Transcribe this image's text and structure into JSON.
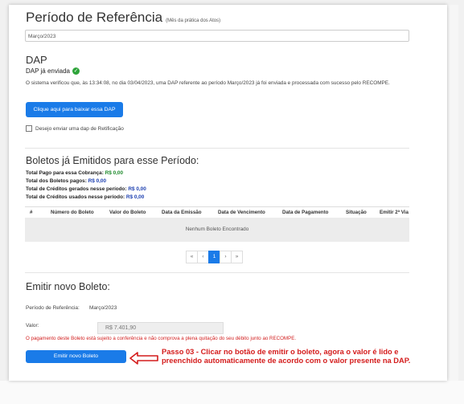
{
  "header": {
    "title": "Período de Referência",
    "subtitle": "(Mês da prática dos Atos)"
  },
  "period_select": {
    "value": "Março/2023"
  },
  "dap": {
    "title": "DAP",
    "status": "DAP já enviada",
    "description": "O sistema verificou que, às 13:34:08, no dia 03/04/2023, uma DAP referente ao período Março/2023 já foi enviada e processada com sucesso pelo RECOMPE.",
    "download_button": "Clique aqui para baixar essa DAP",
    "rectification_label": "Desejo enviar uma dap de Retificação",
    "status_color": "#2ea43a"
  },
  "boletos": {
    "title": "Boletos já Emitidos para esse Período:",
    "summary": [
      {
        "label": "Total Pago para essa Cobrança:",
        "value": "R$ 0,00",
        "color": "#1e8a2c"
      },
      {
        "label": "Total dos Boletos pagos:",
        "value": "R$ 0,00",
        "color": "#1c3fb0"
      },
      {
        "label": "Total de Créditos gerados nesse período:",
        "value": "R$ 0,00",
        "color": "#1c3fb0"
      },
      {
        "label": "Total de Créditos usados nesse período:",
        "value": "R$ 0,00",
        "color": "#1c3fb0"
      }
    ],
    "columns": [
      "#",
      "Número do Boleto",
      "Valor do Boleto",
      "Data da Emissão",
      "Data de Vencimento",
      "Data de Pagamento",
      "Situação",
      "Emitir 2ª Via"
    ],
    "empty_message": "Nenhum Boleto Encontrado",
    "pagination": [
      "«",
      "‹",
      "1",
      "›",
      "»"
    ],
    "active_page": "1"
  },
  "emitir": {
    "title": "Emitir novo Boleto:",
    "period_label": "Período de Referência:",
    "period_value": "Março/2023",
    "valor_label": "Valor:",
    "valor_value": "R$ 7.401,90",
    "warning": "O pagamento deste Boleto está sujeito a conferência e não comprova a plena quitação do seu débito junto ao RECOMPE.",
    "button": "Emitir novo Boleto"
  },
  "annotation": {
    "text": "Passo 03 - Clicar no botão de emitir o boleto, agora o valor é lido e preenchido automaticamente de acordo com o valor presente na DAP.",
    "color": "#d41c1c"
  },
  "colors": {
    "primary": "#1a7be8",
    "warning": "#d21f1f"
  }
}
